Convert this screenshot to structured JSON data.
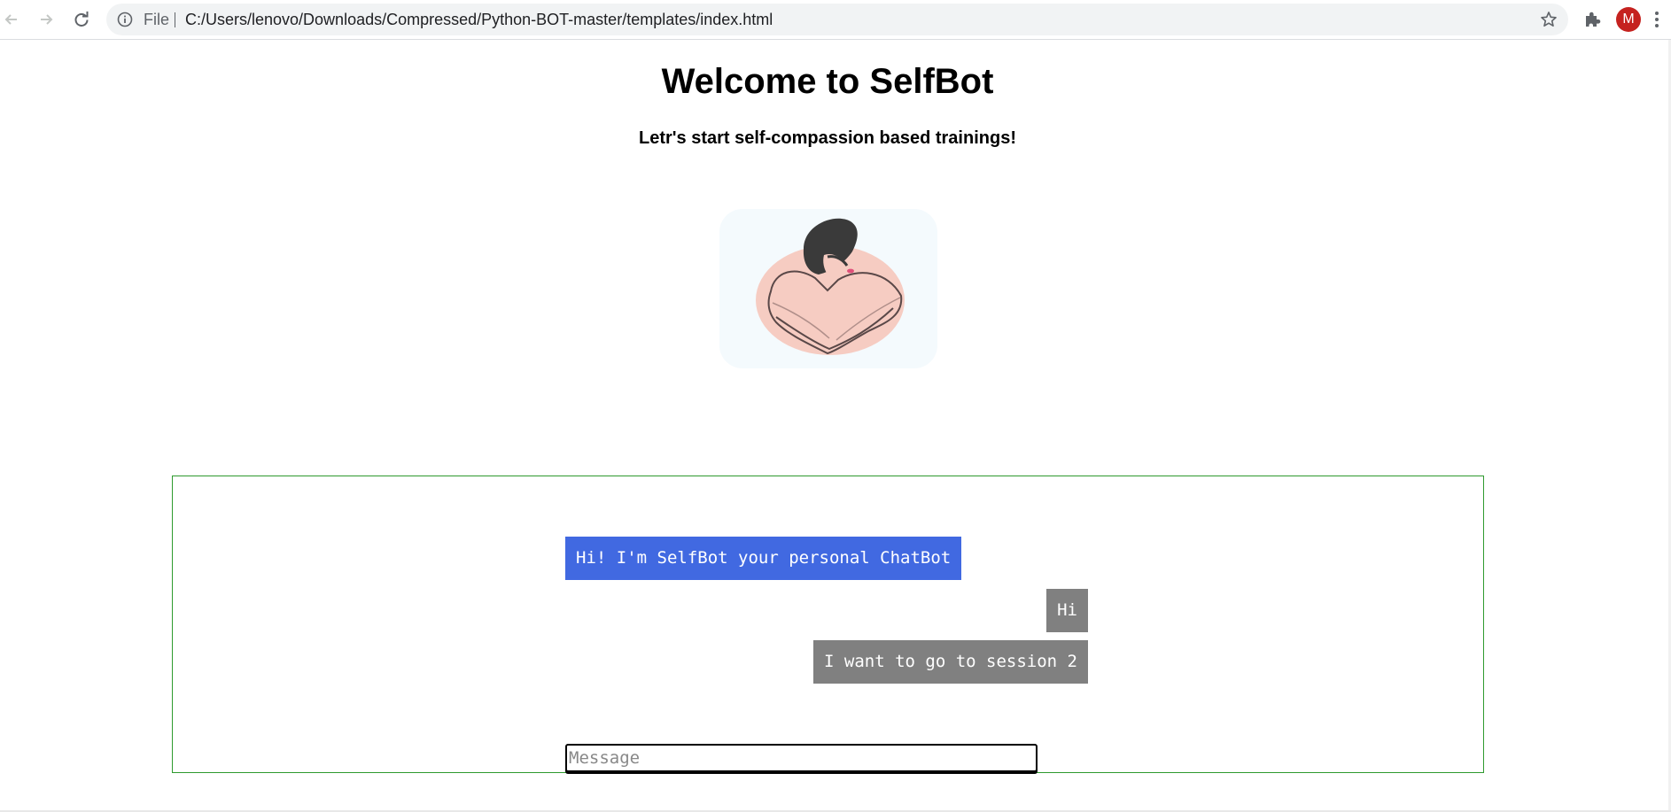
{
  "browser": {
    "scheme_label": "File",
    "url": "C:/Users/lenovo/Downloads/Compressed/Python-BOT-master/templates/index.html",
    "profile_initial": "M",
    "icons": [
      "back-icon",
      "forward-icon",
      "reload-icon",
      "info-icon",
      "star-icon",
      "extensions-icon",
      "menu-icon"
    ]
  },
  "page": {
    "title": "Welcome to SelfBot",
    "subtitle": "Letr's start self-compassion based trainings!"
  },
  "chat": {
    "messages": [
      {
        "sender": "bot",
        "text": "Hi! I'm SelfBot your personal ChatBot"
      },
      {
        "sender": "user",
        "text": "Hi"
      },
      {
        "sender": "user",
        "text": "I want to go to session 2"
      }
    ],
    "input": {
      "placeholder": "Message",
      "value": ""
    }
  },
  "colors": {
    "bot_bubble": "#4169e1",
    "user_bubble": "#808080",
    "chat_border": "#2e9a2e",
    "avatar": "#c5221f"
  }
}
